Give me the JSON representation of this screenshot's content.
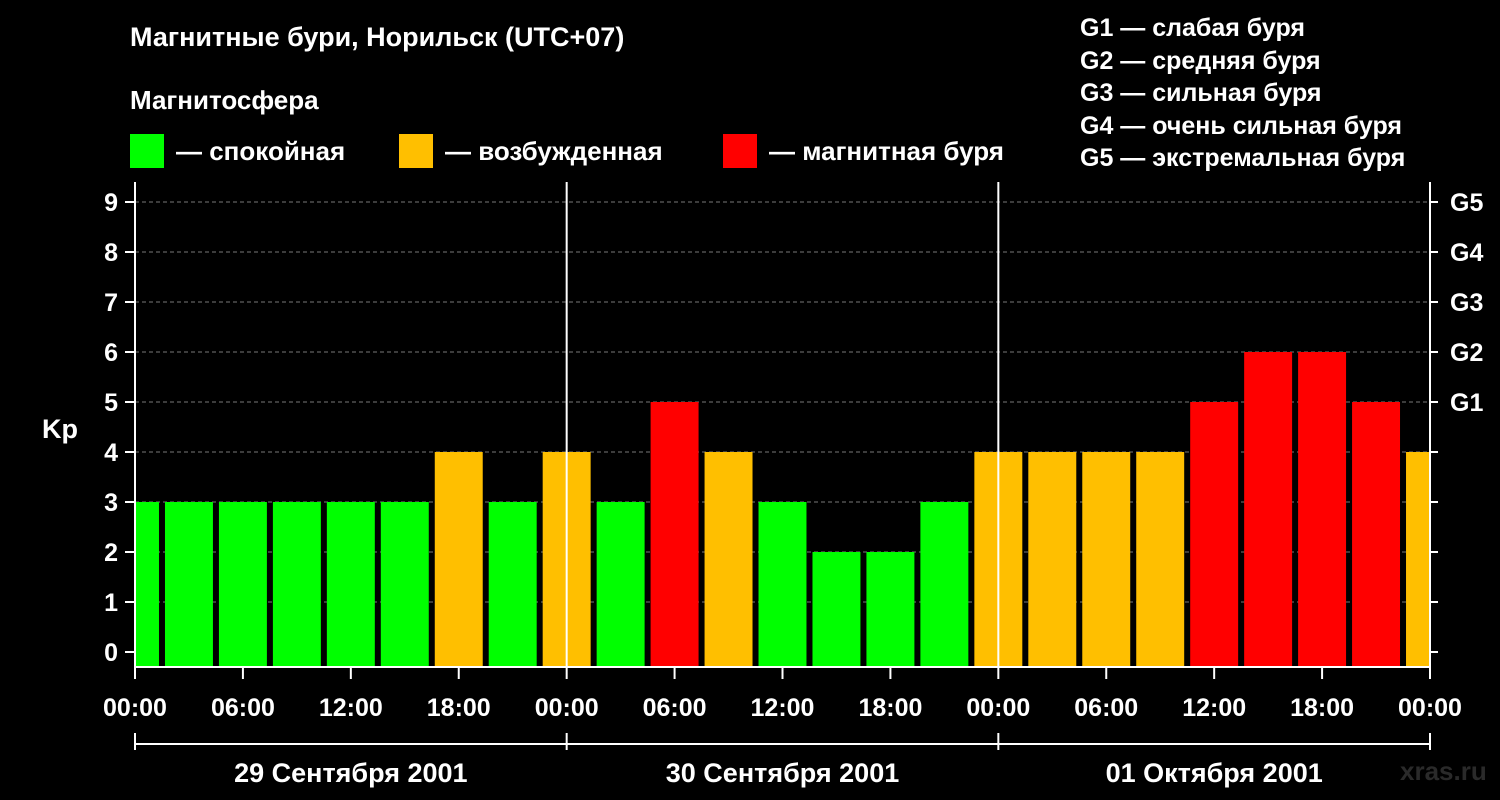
{
  "title": "Магнитные бури, Норильск (UTC+07)",
  "legend": {
    "title": "Магнитосфера",
    "items": [
      {
        "label": "— спокойная",
        "color": "#00ff00"
      },
      {
        "label": "— возбужденная",
        "color": "#ffbf00"
      },
      {
        "label": "— магнитная буря",
        "color": "#ff0000"
      }
    ]
  },
  "g_legend": [
    "G1 — слабая буря",
    "G2 — средняя буря",
    "G3 — сильная буря",
    "G4 — очень сильная буря",
    "G5 — экстремальная буря"
  ],
  "watermark": "xras.ru",
  "chart_data": {
    "type": "bar",
    "ylabel": "Kp",
    "ylim": [
      0,
      9
    ],
    "yticks": [
      0,
      1,
      2,
      3,
      4,
      5,
      6,
      7,
      8,
      9
    ],
    "right_ticks": [
      {
        "y": 5,
        "label": "G1"
      },
      {
        "y": 6,
        "label": "G2"
      },
      {
        "y": 7,
        "label": "G3"
      },
      {
        "y": 8,
        "label": "G4"
      },
      {
        "y": 9,
        "label": "G5"
      }
    ],
    "x_tick_labels": [
      "00:00",
      "06:00",
      "12:00",
      "18:00",
      "00:00",
      "06:00",
      "12:00",
      "18:00",
      "00:00",
      "06:00",
      "12:00",
      "18:00",
      "00:00"
    ],
    "days": [
      "29 Сентября 2001",
      "30 Сентября 2001",
      "01 Октября 2001"
    ],
    "grid": "dashed horizontal",
    "bar_hours": 3,
    "series": [
      {
        "values": [
          3,
          3,
          3,
          3,
          3,
          3,
          4,
          3,
          4,
          3,
          5,
          4,
          3,
          2,
          2,
          3,
          4,
          4,
          4,
          4,
          5,
          6,
          6,
          5,
          4
        ]
      }
    ]
  }
}
